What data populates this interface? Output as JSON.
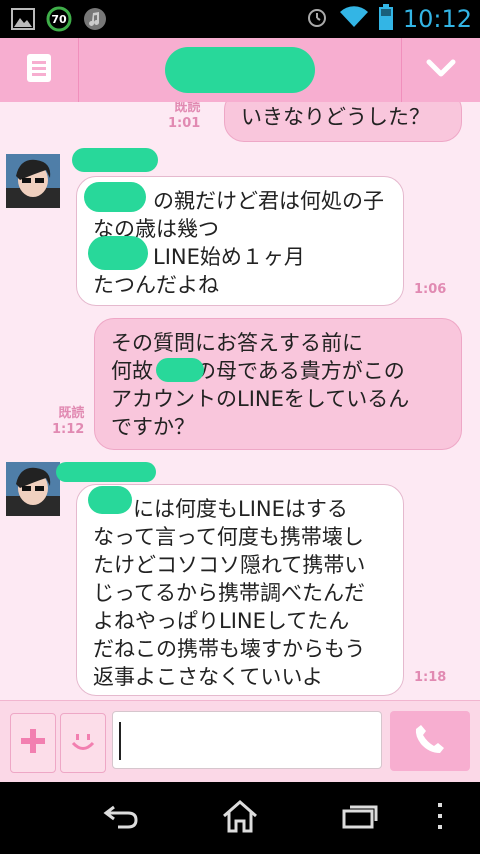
{
  "status_bar": {
    "time": "10:12",
    "battery_badge": "70",
    "icons": [
      "image-icon",
      "battery-saver-icon",
      "music-icon",
      "alarm-icon",
      "wifi-icon",
      "battery-icon"
    ]
  },
  "header": {
    "left_icon": "menu-icon",
    "right_icon": "chevron-down-icon",
    "title_redacted": true
  },
  "messages": [
    {
      "direction": "out",
      "read_label": "既読",
      "time": "1:01",
      "lines": [
        "いきなりどうした？"
      ]
    },
    {
      "direction": "in",
      "time": "1:06",
      "lines": [
        "の親だけど君は何処の子",
        "なの歳は幾つ",
        "LINE始め１ヶ月",
        "たつんだよね"
      ]
    },
    {
      "direction": "out",
      "read_label": "既読",
      "time": "1:12",
      "lines": [
        "その質問にお答えする前に",
        "何故　　の母である貴方がこの",
        "アカウントのLINEをしているん",
        "ですか？"
      ]
    },
    {
      "direction": "in",
      "time": "1:18",
      "lines": [
        "には何度もLINEはする",
        "なって言って何度も携帯壊し",
        "たけどコソコソ隠れて携帯い",
        "じってるから携帯調べたんだ",
        "よねやっぱりLINEしてたん",
        "だねこの携帯も壊すからもう",
        "返事よこさなくていいよ"
      ]
    }
  ],
  "input_bar": {
    "message_value": ""
  },
  "nav": {
    "icons": [
      "back-icon",
      "home-icon",
      "recent-apps-icon",
      "overflow-menu-icon"
    ]
  },
  "colors": {
    "accent": "#f7aed0",
    "background": "#fde9f3",
    "time_text": "#e18ab2",
    "redaction": "#28d89a",
    "status_time": "#33b5e5"
  }
}
